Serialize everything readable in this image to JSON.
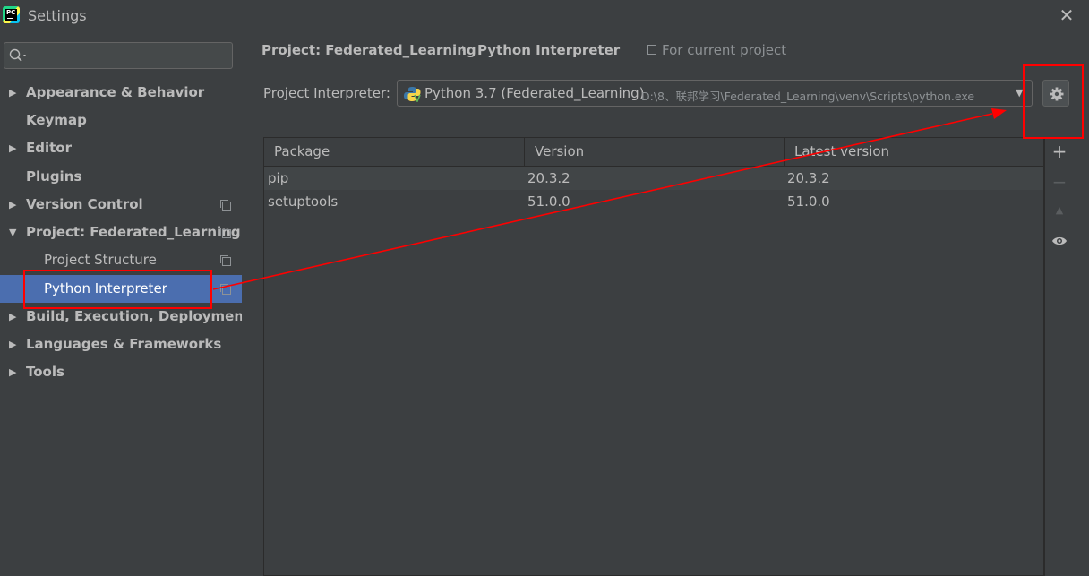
{
  "window": {
    "title": "Settings",
    "close_glyph": "✕",
    "app_icon": "PC"
  },
  "search": {
    "placeholder": "",
    "icon": "search-icon"
  },
  "sidebar": {
    "items": [
      {
        "label": "Appearance & Behavior",
        "expandable": true,
        "expanded": false,
        "copy_icon": false
      },
      {
        "label": "Keymap",
        "expandable": false,
        "copy_icon": false
      },
      {
        "label": "Editor",
        "expandable": true,
        "expanded": false,
        "copy_icon": false
      },
      {
        "label": "Plugins",
        "expandable": false,
        "copy_icon": false
      },
      {
        "label": "Version Control",
        "expandable": true,
        "expanded": false,
        "copy_icon": true
      },
      {
        "label": "Project: Federated_Learning",
        "expandable": true,
        "expanded": true,
        "copy_icon": true
      },
      {
        "label": "Project Structure",
        "sub": true,
        "copy_icon": true
      },
      {
        "label": "Python Interpreter",
        "sub": true,
        "selected": true,
        "copy_icon": true
      },
      {
        "label": "Build, Execution, Deployment",
        "expandable": true,
        "expanded": false,
        "copy_icon": false
      },
      {
        "label": "Languages & Frameworks",
        "expandable": true,
        "expanded": false,
        "copy_icon": false
      },
      {
        "label": "Tools",
        "expandable": true,
        "expanded": false,
        "copy_icon": false
      }
    ]
  },
  "breadcrumb": {
    "parent": "Project: Federated_Learning",
    "separator": "›",
    "current": "Python Interpreter",
    "scope": "For current project"
  },
  "interpreter": {
    "label": "Project Interpreter:",
    "name": "Python 3.7 (Federated_Learning)",
    "path": "D:\\8、联邦学习\\Federated_Learning\\venv\\Scripts\\python.exe"
  },
  "packages": {
    "columns": [
      "Package",
      "Version",
      "Latest version"
    ],
    "rows": [
      [
        "pip",
        "20.3.2",
        "20.3.2"
      ],
      [
        "setuptools",
        "51.0.0",
        "51.0.0"
      ]
    ]
  },
  "tools": {
    "add": "+",
    "remove": "−",
    "upgrade": "▲",
    "show": "eye-icon"
  },
  "colors": {
    "background": "#3c3f41",
    "selection": "#4b6eaf",
    "annotation": "#ff0000"
  }
}
